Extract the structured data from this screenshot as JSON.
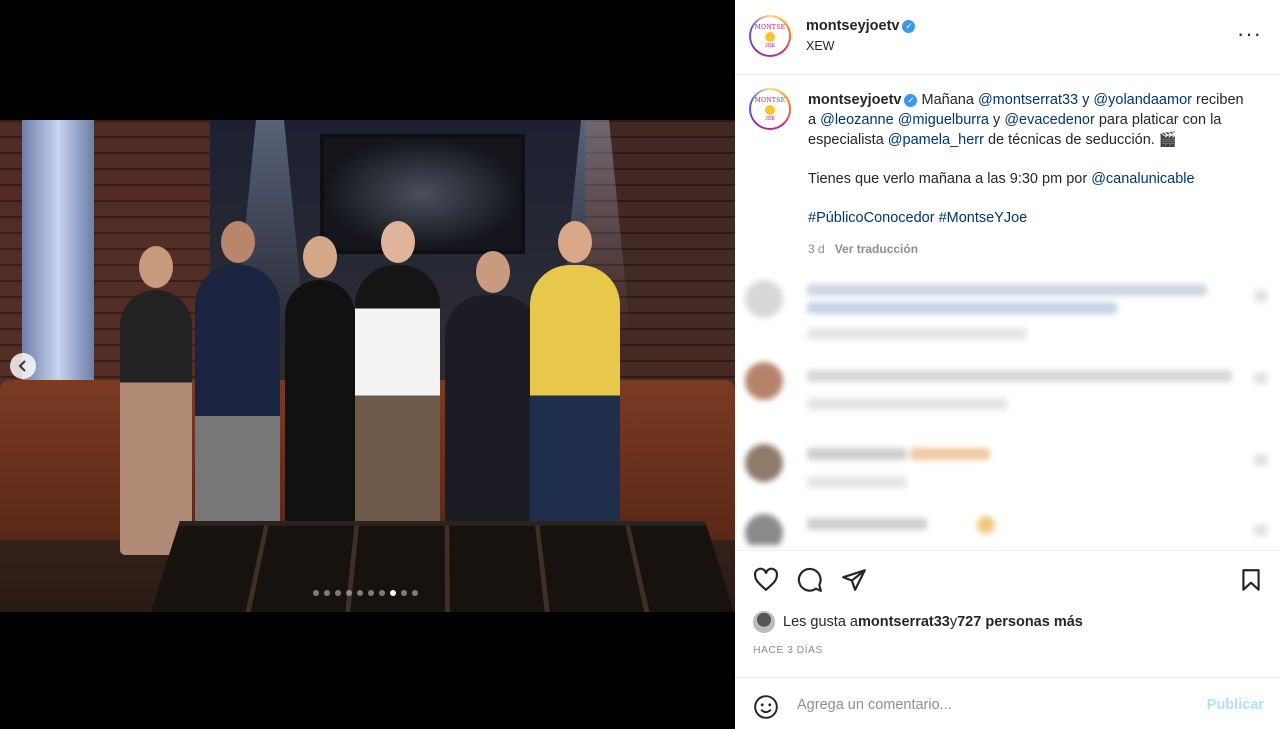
{
  "post": {
    "account": "montseyjoetv",
    "location": "XEW",
    "avatar_logo": {
      "top": "MONTSE",
      "bottom": "JOE"
    },
    "carousel": {
      "total": 10,
      "active": 8
    }
  },
  "caption": {
    "username": "montseyjoetv",
    "line1": [
      {
        "t": "Mañana ",
        "m": false
      },
      {
        "t": "@montserrat33",
        "m": true
      },
      {
        "t": " y ",
        "m": false
      },
      {
        "t": "@yolandaamor",
        "m": true
      },
      {
        "t": " reciben a ",
        "m": false
      },
      {
        "t": "@leozanne",
        "m": true
      },
      {
        "t": " ",
        "m": false
      },
      {
        "t": "@miguelburra",
        "m": true
      },
      {
        "t": " y ",
        "m": false
      },
      {
        "t": "@evacedenor",
        "m": true
      },
      {
        "t": " para platicar con la especialista ",
        "m": false
      },
      {
        "t": "@pamela_herr",
        "m": true
      },
      {
        "t": " de técnicas de seducción. 🎬",
        "m": false
      }
    ],
    "line2_text": "Tienes que verlo mañana a las 9:30 pm por ",
    "line2_mention": "@canalunicable",
    "hashtags": "#PúblicoConocedor #MontseYJoe",
    "age": "3 d",
    "translate": "Ver traducción"
  },
  "likes": {
    "prefix": "Les gusta a ",
    "user": "montserrat33",
    "joiner": " y ",
    "others": "727 personas más"
  },
  "timestamp": "HACE 3 DÍAS",
  "comment_box": {
    "placeholder": "Agrega un comentario...",
    "publish": "Publicar"
  },
  "colors": {
    "mention": "#00376b",
    "verified": "#3897f0",
    "publish_disabled": "#b2dffc"
  },
  "icons": [
    "heart-icon",
    "comment-icon",
    "share-icon",
    "bookmark-icon",
    "emoji-icon",
    "more-icon",
    "verified-icon",
    "chevron-left-icon"
  ]
}
